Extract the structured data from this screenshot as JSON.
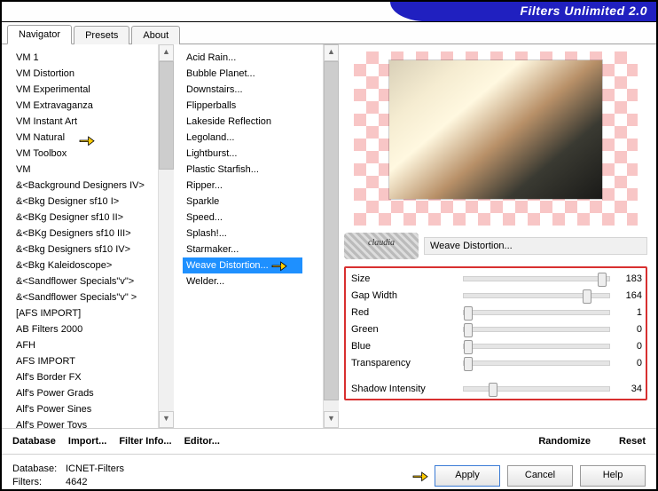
{
  "app_title": "Filters Unlimited 2.0",
  "tabs": [
    "Navigator",
    "Presets",
    "About"
  ],
  "active_tab": 0,
  "categories": [
    "VM 1",
    "VM Distortion",
    "VM Experimental",
    "VM Extravaganza",
    "VM Instant Art",
    "VM Natural",
    "VM Toolbox",
    "VM",
    "&<Background Designers IV>",
    "&<Bkg Designer sf10 I>",
    "&<BKg Designer sf10 II>",
    "&<BKg Designers sf10 III>",
    "&<Bkg Designers sf10 IV>",
    "&<Bkg Kaleidoscope>",
    "&<Sandflower Specials\"v\">",
    "&<Sandflower Specials\"v\" >",
    "[AFS IMPORT]",
    "AB Filters 2000",
    "AFH",
    "AFS IMPORT",
    "Alf's Border FX",
    "Alf's Power Grads",
    "Alf's Power Sines",
    "Alf's Power Toys"
  ],
  "highlight_cat_index": 5,
  "filters": [
    "Acid Rain...",
    "Bubble Planet...",
    "Downstairs...",
    "Flipperballs",
    "Lakeside Reflection",
    "Legoland...",
    "Lightburst...",
    "Plastic Starfish...",
    "Ripper...",
    "Sparkle",
    "Speed...",
    "Splash!...",
    "Starmaker...",
    "Weave Distortion...",
    "Welder..."
  ],
  "selected_filter_index": 13,
  "panel_title": "Weave Distortion...",
  "watermark": "claudia",
  "params": [
    {
      "name": "Size",
      "value": 183,
      "pos": 92
    },
    {
      "name": "Gap Width",
      "value": 164,
      "pos": 82
    },
    {
      "name": "Red",
      "value": 1,
      "pos": 0
    },
    {
      "name": "Green",
      "value": 0,
      "pos": 0
    },
    {
      "name": "Blue",
      "value": 0,
      "pos": 0
    },
    {
      "name": "Transparency",
      "value": 0,
      "pos": 0
    }
  ],
  "shadow": {
    "name": "Shadow Intensity",
    "value": 34,
    "pos": 17
  },
  "link_buttons": [
    "Database",
    "Import...",
    "Filter Info...",
    "Editor..."
  ],
  "right_links": [
    "Randomize",
    "Reset"
  ],
  "footer_db_label": "Database:",
  "footer_db_value": "ICNET-Filters",
  "footer_filters_label": "Filters:",
  "footer_filters_value": "4642",
  "buttons": {
    "apply": "Apply",
    "cancel": "Cancel",
    "help": "Help"
  }
}
